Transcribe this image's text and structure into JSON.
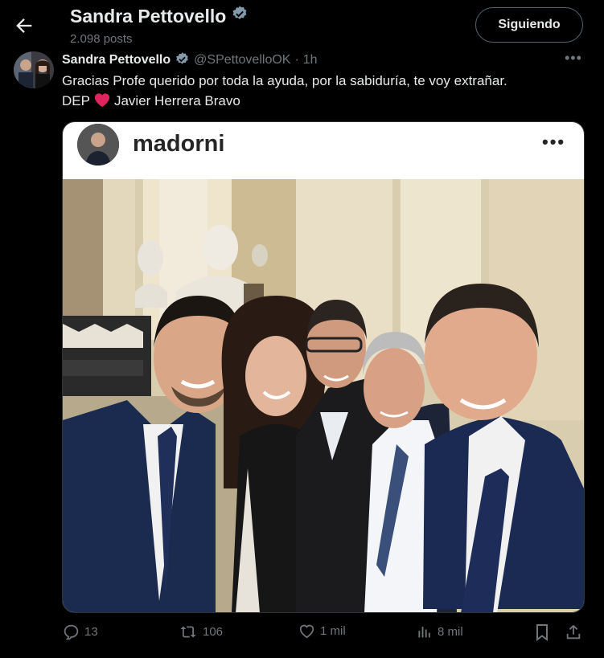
{
  "header": {
    "title": "Sandra Pettovello",
    "posts": "2.098 posts",
    "follow_label": "Siguiendo"
  },
  "tweet": {
    "name": "Sandra Pettovello",
    "handle": "@SPettovelloOK",
    "separator": "·",
    "time": "1h",
    "text_line1": "Gracias Profe querido por toda la ayuda, por la sabiduría, te voy extrañar.",
    "text_line2_a": "DEP",
    "text_line2_b": "Javier Herrera Bravo"
  },
  "media": {
    "ig_username": "madorni"
  },
  "actions": {
    "replies": "13",
    "reposts": "106",
    "likes": "1 mil",
    "views": "8 mil"
  },
  "colors": {
    "background": "#000000",
    "text_primary": "#e7e9ea",
    "text_secondary": "#71767b",
    "verified": "#829aab",
    "heart": "#f91880"
  }
}
